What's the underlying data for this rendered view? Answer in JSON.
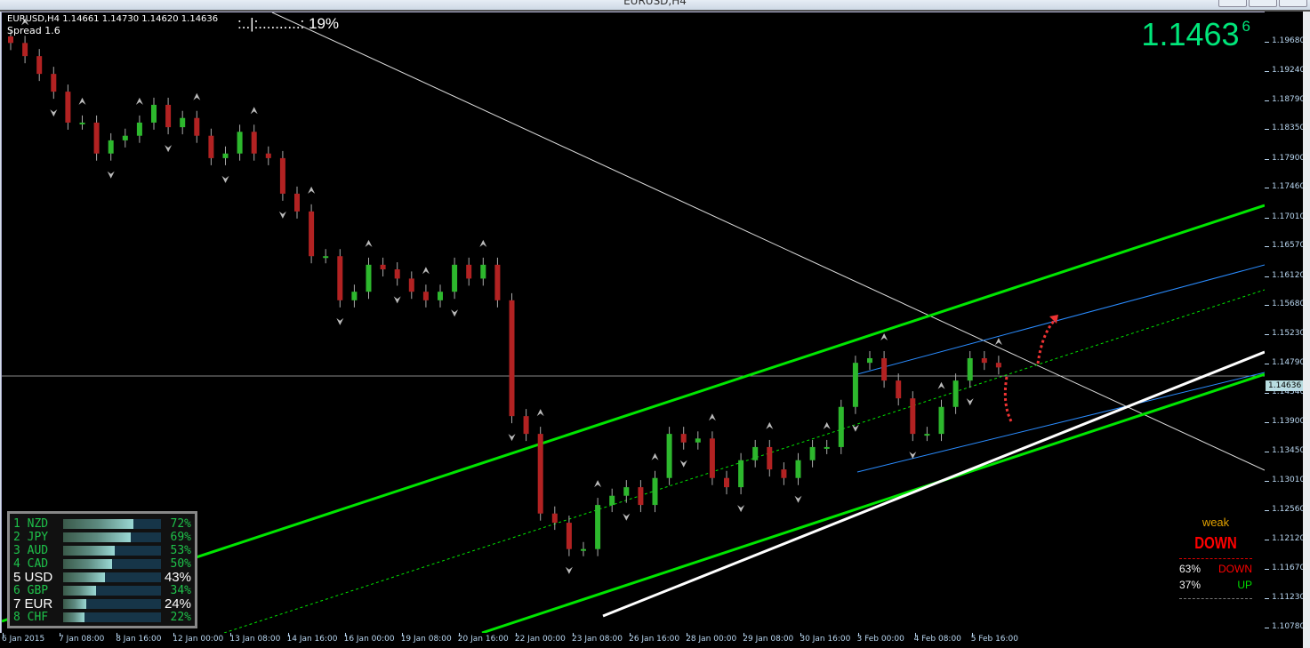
{
  "window": {
    "title": "EURUSD,H4"
  },
  "chart": {
    "symbol_info": "EURUSD,H4  1.14661 1.14730 1.14620 1.14636",
    "spread": "Spread 1.6",
    "progress_text": ":..|:..........: 19%",
    "bid_main": "1.1463",
    "bid_pip": "6",
    "current_price": "1.14636",
    "price_labels": [
      "1.19680",
      "1.19240",
      "1.18790",
      "1.18350",
      "1.17900",
      "1.17460",
      "1.17010",
      "1.16570",
      "1.16120",
      "1.15680",
      "1.15230",
      "1.14790",
      "1.14340",
      "1.13900",
      "1.13450",
      "1.13010",
      "1.12560",
      "1.12120",
      "1.11670",
      "1.11230",
      "1.10780"
    ],
    "time_labels": [
      "6 Jan 2015",
      "7 Jan 08:00",
      "8 Jan 16:00",
      "12 Jan 00:00",
      "13 Jan 08:00",
      "14 Jan 16:00",
      "16 Jan 00:00",
      "19 Jan 08:00",
      "20 Jan 16:00",
      "22 Jan 00:00",
      "23 Jan 08:00",
      "26 Jan 16:00",
      "28 Jan 00:00",
      "29 Jan 08:00",
      "30 Jan 16:00",
      "3 Feb 00:00",
      "4 Feb 08:00",
      "5 Feb 16:00"
    ],
    "closes": [
      1.195,
      1.193,
      1.1903,
      1.1876,
      1.1829,
      1.1829,
      1.1782,
      1.1802,
      1.1809,
      1.1829,
      1.1856,
      1.1822,
      1.1836,
      1.1809,
      1.1775,
      1.1782,
      1.1815,
      1.1782,
      1.1775,
      1.1721,
      1.1694,
      1.1626,
      1.1626,
      1.1559,
      1.1572,
      1.1613,
      1.1606,
      1.1592,
      1.1572,
      1.1559,
      1.1572,
      1.1613,
      1.1592,
      1.1613,
      1.1559,
      1.1383,
      1.1356,
      1.1235,
      1.1221,
      1.1181,
      1.1181,
      1.1248,
      1.1262,
      1.1275,
      1.1248,
      1.1289,
      1.1356,
      1.1343,
      1.1349,
      1.1289,
      1.1275,
      1.1316,
      1.1336,
      1.1302,
      1.1289,
      1.1316,
      1.1336,
      1.1336,
      1.1397,
      1.1464,
      1.1471,
      1.1437,
      1.141,
      1.1356,
      1.1356,
      1.1397,
      1.1437,
      1.1471,
      1.1464,
      1.1457
    ],
    "colors": {
      "bull": "#2db82d",
      "bear": "#b22222",
      "channel": "#00e600",
      "blue": "#2a8cff"
    }
  },
  "currency_meter": [
    {
      "label": "1 NZD",
      "pct": "72%",
      "value": 72,
      "white": false
    },
    {
      "label": "2 JPY",
      "pct": "69%",
      "value": 69,
      "white": false
    },
    {
      "label": "3 AUD",
      "pct": "53%",
      "value": 53,
      "white": false
    },
    {
      "label": "4 CAD",
      "pct": "50%",
      "value": 50,
      "white": false
    },
    {
      "label": "5 USD",
      "pct": "43%",
      "value": 43,
      "white": true
    },
    {
      "label": "6 GBP",
      "pct": "34%",
      "value": 34,
      "white": false
    },
    {
      "label": "7 EUR",
      "pct": "24%",
      "value": 24,
      "white": true
    },
    {
      "label": "8 CHF",
      "pct": "22%",
      "value": 22,
      "white": false
    }
  ],
  "signal": {
    "strength": "weak",
    "direction": "DOWN",
    "down_pct": "63%",
    "down_label": "DOWN",
    "up_pct": "37%",
    "up_label": "UP"
  }
}
